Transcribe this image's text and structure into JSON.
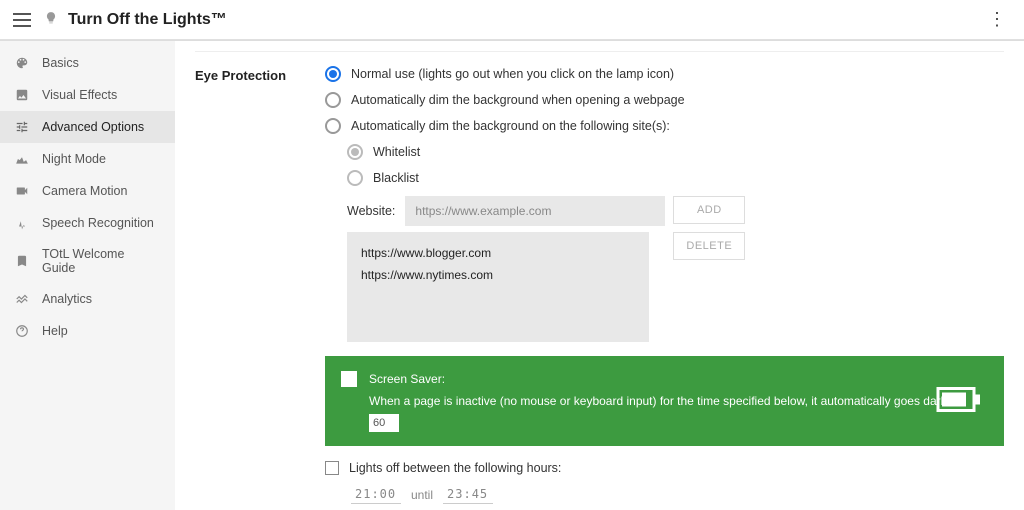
{
  "header": {
    "title": "Turn Off the Lights™"
  },
  "sidebar": {
    "items": [
      {
        "label": "Basics",
        "icon": "palette"
      },
      {
        "label": "Visual Effects",
        "icon": "photo"
      },
      {
        "label": "Advanced Options",
        "icon": "sliders",
        "active": true
      },
      {
        "label": "Night Mode",
        "icon": "night"
      },
      {
        "label": "Camera Motion",
        "icon": "camera"
      },
      {
        "label": "Speech Recognition",
        "icon": "speech"
      },
      {
        "label": "TOtL Welcome Guide",
        "icon": "bookmark"
      },
      {
        "label": "Analytics",
        "icon": "analytics"
      },
      {
        "label": "Help",
        "icon": "help"
      }
    ]
  },
  "section": {
    "title": "Eye Protection",
    "radios": {
      "normal": "Normal use (lights go out when you click on the lamp icon)",
      "auto_all": "Automatically dim the background when opening a webpage",
      "auto_sites": "Automatically dim the background on the following site(s):",
      "whitelist": "Whitelist",
      "blacklist": "Blacklist"
    },
    "website": {
      "label": "Website:",
      "placeholder": "https://www.example.com",
      "add": "ADD",
      "delete": "DELETE",
      "list": [
        "https://www.blogger.com",
        "https://www.nytimes.com"
      ]
    },
    "screensaver": {
      "title": "Screen Saver:",
      "desc": "When a page is inactive (no mouse or keyboard input) for the time specified below, it automatically goes dark.",
      "value": "60"
    },
    "hours": {
      "label": "Lights off between the following hours:",
      "from": "21:00",
      "until_label": "until",
      "until": "23:45"
    }
  }
}
